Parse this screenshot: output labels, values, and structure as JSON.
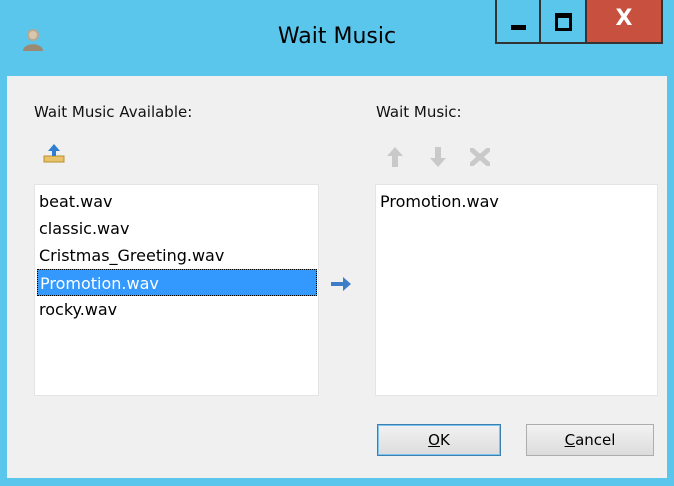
{
  "window": {
    "title": "Wait Music",
    "minimize_glyph": "",
    "close_glyph": "X"
  },
  "available": {
    "label": "Wait Music Available:",
    "items": [
      "beat.wav",
      "classic.wav",
      "Cristmas_Greeting.wav",
      "Promotion.wav",
      "rocky.wav"
    ],
    "selected_index": 3
  },
  "wait": {
    "label": "Wait Music:",
    "items": [
      "Promotion.wav"
    ]
  },
  "buttons": {
    "ok": "OK",
    "cancel": "Cancel"
  },
  "icons": {
    "import": "import-upload-icon",
    "up": "move-up-arrow-icon",
    "down": "move-down-arrow-icon",
    "delete": "delete-x-icon",
    "add": "add-right-arrow-icon",
    "app": "user-avatar-icon"
  },
  "colors": {
    "titlebar": "#5bc6ec",
    "close": "#c7503e",
    "selection": "#3399ff",
    "dialog_bg": "#f0f0f0"
  }
}
